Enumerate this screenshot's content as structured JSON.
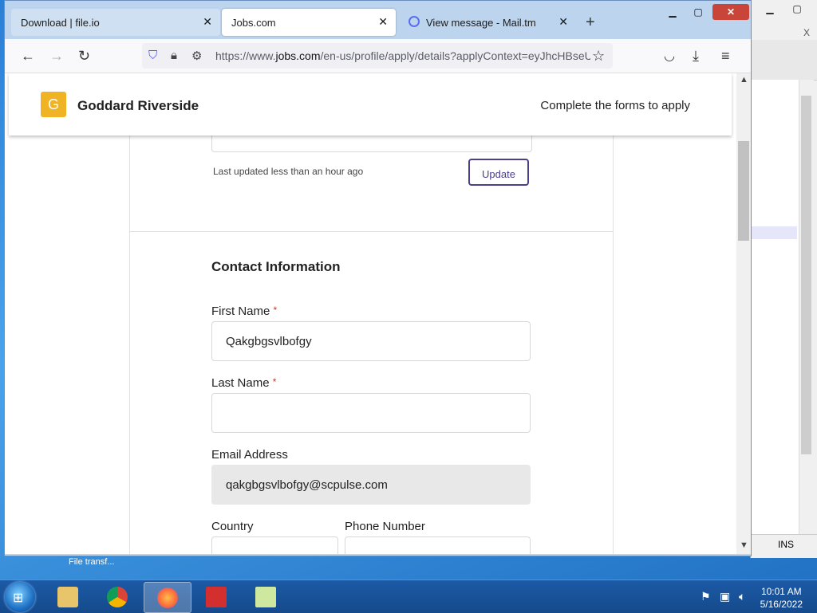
{
  "browser": {
    "tabs": [
      {
        "label": "Download | file.io",
        "close": "✕"
      },
      {
        "label": "Jobs.com",
        "close": "✕"
      },
      {
        "label": "View message - Mail.tm",
        "close": "✕"
      }
    ],
    "new_tab": "+",
    "window_controls": {
      "minimize": "▁",
      "maximize": "▢",
      "close": "✕"
    },
    "url_prefix": "https://www.",
    "url_domain": "jobs.com",
    "url_rest": "/en-us/profile/apply/details?applyContext=eyJhcHBseU"
  },
  "header": {
    "logo_letter": "G",
    "company": "Goddard Riverside",
    "instruction": "Complete the forms to apply"
  },
  "resume": {
    "last_updated": "Last updated less than an hour ago",
    "update_button": "Update"
  },
  "contact": {
    "title": "Contact Information",
    "first_name_label": "First Name",
    "first_name_value": "Qakgbgsvlbofgy",
    "last_name_label": "Last Name",
    "last_name_value": "",
    "email_label": "Email Address",
    "email_value": "qakgbgsvlbofgy@scpulse.com",
    "country_label": "Country",
    "phone_label": "Phone Number",
    "required_mark": "*"
  },
  "background_window": {
    "x_label": "X",
    "status": "INS"
  },
  "taskbar": {
    "notification": "File transf...",
    "time": "10:01 AM",
    "date": "5/16/2022"
  },
  "colors": {
    "logo": "#f0b323",
    "accent_button": "#4b3f8a",
    "required": "#c0392b"
  }
}
